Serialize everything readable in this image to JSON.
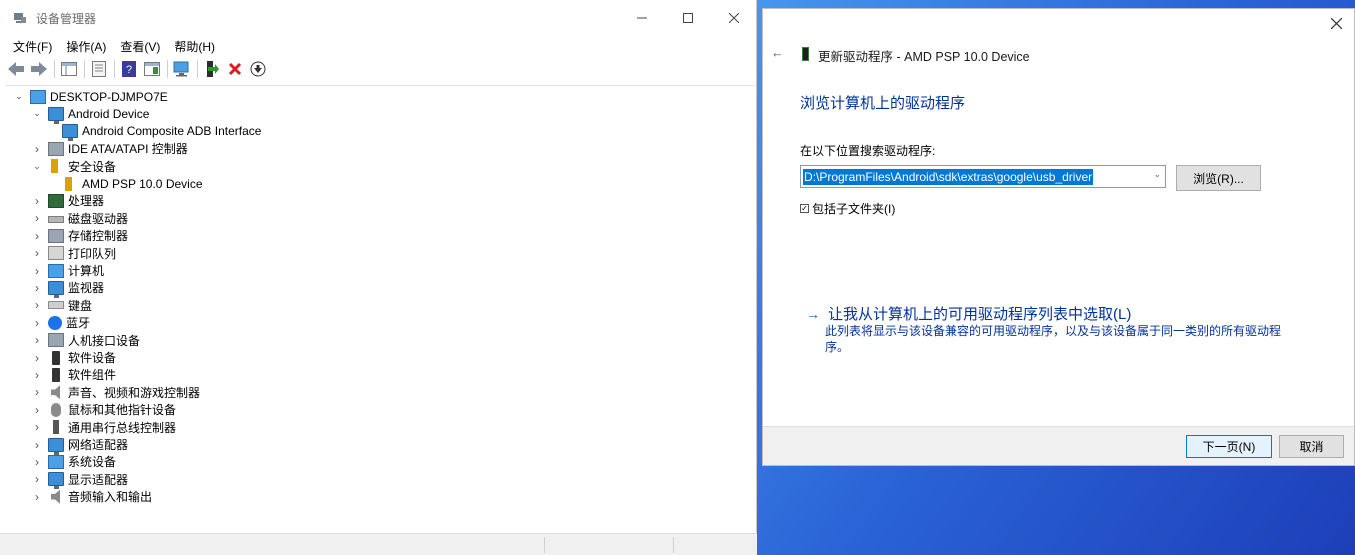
{
  "device_manager": {
    "title": "设备管理器",
    "menu": [
      "文件(F)",
      "操作(A)",
      "查看(V)",
      "帮助(H)"
    ],
    "tree": [
      {
        "label": "DESKTOP-DJMPO7E",
        "level": 0,
        "expanded": true,
        "icon": "computer-icon"
      },
      {
        "label": "Android Device",
        "level": 1,
        "expanded": true,
        "icon": "android-device-icon"
      },
      {
        "label": "Android Composite ADB Interface",
        "level": 2,
        "icon": "adb-interface-icon"
      },
      {
        "label": "IDE ATA/ATAPI 控制器",
        "level": 1,
        "expanded": false,
        "icon": "ide-controller-icon"
      },
      {
        "label": "安全设备",
        "level": 1,
        "expanded": true,
        "icon": "security-device-icon"
      },
      {
        "label": "AMD PSP 10.0 Device",
        "level": 2,
        "icon": "psp-device-icon"
      },
      {
        "label": "处理器",
        "level": 1,
        "expanded": false,
        "icon": "processor-icon"
      },
      {
        "label": "磁盘驱动器",
        "level": 1,
        "expanded": false,
        "icon": "disk-drive-icon"
      },
      {
        "label": "存储控制器",
        "level": 1,
        "expanded": false,
        "icon": "storage-controller-icon"
      },
      {
        "label": "打印队列",
        "level": 1,
        "expanded": false,
        "icon": "printer-icon"
      },
      {
        "label": "计算机",
        "level": 1,
        "expanded": false,
        "icon": "computer-icon"
      },
      {
        "label": "监视器",
        "level": 1,
        "expanded": false,
        "icon": "monitor-icon"
      },
      {
        "label": "键盘",
        "level": 1,
        "expanded": false,
        "icon": "keyboard-icon"
      },
      {
        "label": "蓝牙",
        "level": 1,
        "expanded": false,
        "icon": "bluetooth-icon"
      },
      {
        "label": "人机接口设备",
        "level": 1,
        "expanded": false,
        "icon": "hid-icon"
      },
      {
        "label": "软件设备",
        "level": 1,
        "expanded": false,
        "icon": "software-device-icon"
      },
      {
        "label": "软件组件",
        "level": 1,
        "expanded": false,
        "icon": "software-component-icon"
      },
      {
        "label": "声音、视频和游戏控制器",
        "level": 1,
        "expanded": false,
        "icon": "speaker-icon"
      },
      {
        "label": "鼠标和其他指针设备",
        "level": 1,
        "expanded": false,
        "icon": "mouse-icon"
      },
      {
        "label": "通用串行总线控制器",
        "level": 1,
        "expanded": false,
        "icon": "usb-icon"
      },
      {
        "label": "网络适配器",
        "level": 1,
        "expanded": false,
        "icon": "network-adapter-icon"
      },
      {
        "label": "系统设备",
        "level": 1,
        "expanded": false,
        "icon": "system-device-icon"
      },
      {
        "label": "显示适配器",
        "level": 1,
        "expanded": false,
        "icon": "display-adapter-icon"
      },
      {
        "label": "音频输入和输出",
        "level": 1,
        "expanded": false,
        "icon": "audio-io-icon"
      }
    ]
  },
  "update_dialog": {
    "title": "更新驱动程序 - AMD PSP 10.0 Device",
    "heading": "浏览计算机上的驱动程序",
    "search_label": "在以下位置搜索驱动程序:",
    "path_value": "D:\\ProgramFiles\\Android\\sdk\\extras\\google\\usb_driver",
    "browse_label": "浏览(R)...",
    "include_subfolders_label": "包括子文件夹(I)",
    "include_subfolders_checked": true,
    "pick_link": "让我从计算机上的可用驱动程序列表中选取(L)",
    "pick_desc": "此列表将显示与该设备兼容的可用驱动程序，以及与该设备属于同一类别的所有驱动程序。",
    "next_label": "下一页(N)",
    "cancel_label": "取消"
  },
  "colors": {
    "link_blue": "#003399",
    "selection": "#0078d7",
    "desktop_bg": "#2a64d6"
  }
}
